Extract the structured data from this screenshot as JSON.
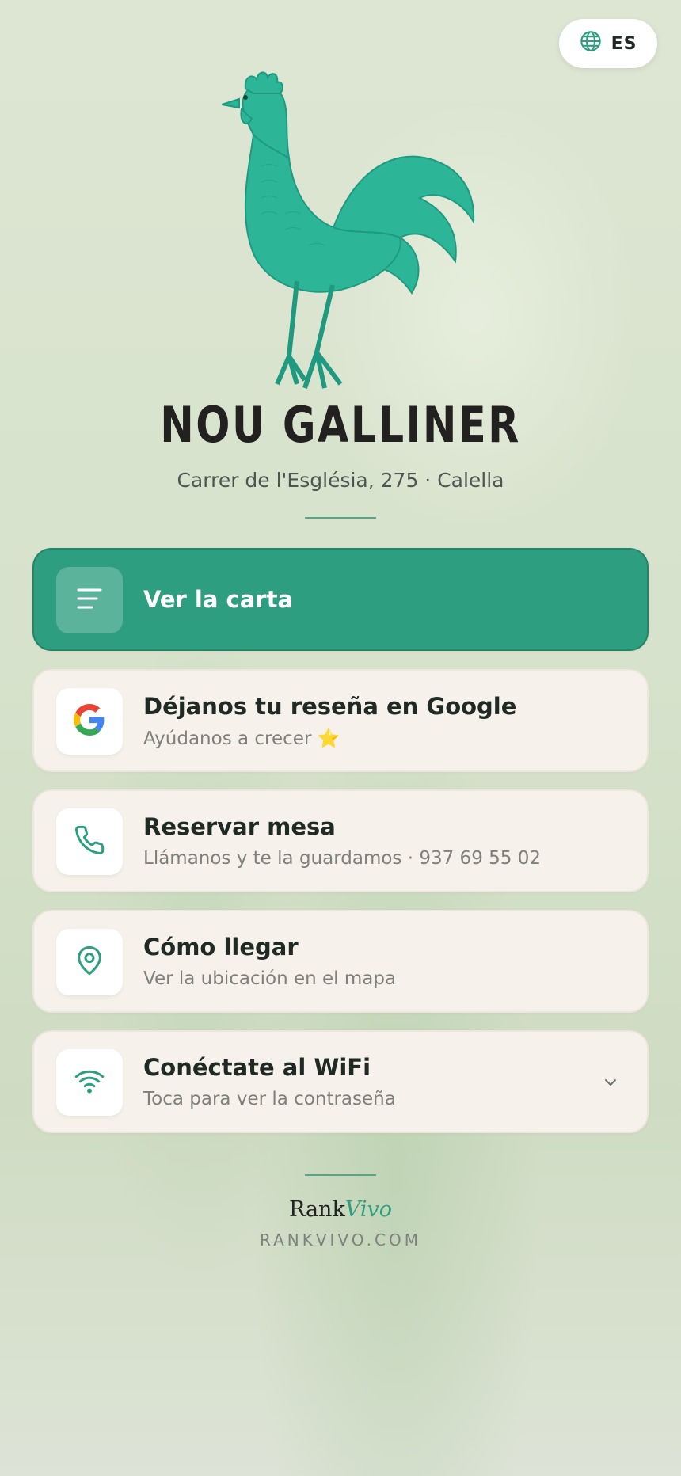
{
  "language": {
    "code": "ES",
    "icon": "globe-icon"
  },
  "restaurant": {
    "name": "NOU GALLINER",
    "address": "Carrer de l'Església, 275 · Calella",
    "logo": "rooster-illustration"
  },
  "actions": [
    {
      "id": "menu",
      "title": "Ver la carta",
      "subtitle": "",
      "icon": "menu-lines-icon"
    },
    {
      "id": "review",
      "title": "Déjanos tu reseña en Google",
      "subtitle": "Ayúdanos a crecer ⭐",
      "icon": "google-icon"
    },
    {
      "id": "reserve",
      "title": "Reservar mesa",
      "subtitle": "Llámanos y te la guardamos · 937 69 55 02",
      "icon": "phone-icon"
    },
    {
      "id": "directions",
      "title": "Cómo llegar",
      "subtitle": "Ver la ubicación en el mapa",
      "icon": "map-pin-icon"
    },
    {
      "id": "wifi",
      "title": "Conéctate al WiFi",
      "subtitle": "Toca para ver la contraseña",
      "icon": "wifi-icon"
    }
  ],
  "footer": {
    "brand_main": "Rank",
    "brand_accent": "Vivo",
    "url": "RANKVIVO.COM"
  },
  "colors": {
    "accent": "#2e9e80",
    "card": "#f6f1ea",
    "background": "#d6e2cb"
  }
}
